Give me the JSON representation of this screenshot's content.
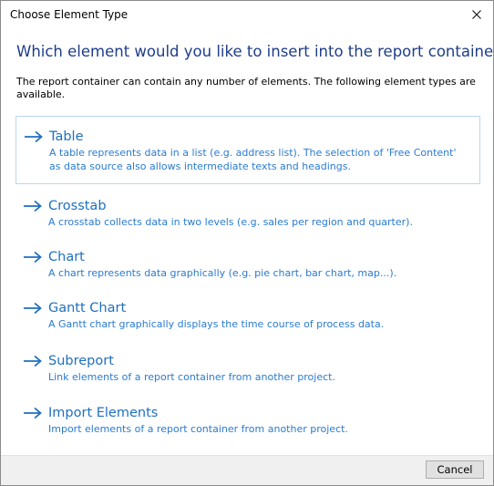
{
  "window": {
    "title": "Choose Element Type"
  },
  "heading": "Which element would you like to insert into the report container?",
  "intro": "The report container can contain any number of elements. The following element types are available.",
  "options": [
    {
      "label": "Table",
      "desc": "A table represents data in a list (e.g. address list). The selection of 'Free Content' as data source also allows intermediate texts and headings.",
      "selected": true
    },
    {
      "label": "Crosstab",
      "desc": "A crosstab collects data in two levels (e.g. sales per region and quarter).",
      "selected": false
    },
    {
      "label": "Chart",
      "desc": "A chart represents data graphically (e.g. pie chart, bar chart, map...).",
      "selected": false
    },
    {
      "label": "Gantt Chart",
      "desc": "A Gantt chart graphically displays the time course of process data.",
      "selected": false
    },
    {
      "label": "Subreport",
      "desc": "Link elements of a report container from another project.",
      "selected": false
    },
    {
      "label": "Import Elements",
      "desc": "Import elements of a report container from another project.",
      "selected": false
    }
  ],
  "footer": {
    "cancel_label": "Cancel"
  },
  "colors": {
    "heading": "#1f3d8a",
    "option_label": "#1f6fc0",
    "option_desc": "#2a7bd0",
    "arrow": "#1f6fc0",
    "selected_border": "#b9d7f2"
  },
  "icons": {
    "option_arrow": "arrow-right-icon",
    "close": "close-icon"
  }
}
